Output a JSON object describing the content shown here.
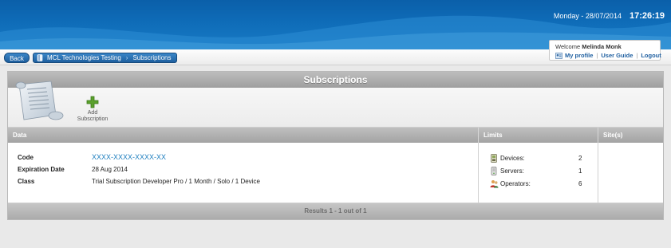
{
  "header": {
    "date": "Monday - 28/07/2014",
    "time": "17:26:19"
  },
  "nav": {
    "back_label": "Back",
    "breadcrumb": [
      "MCL Technologies Testing",
      "Subscriptions"
    ]
  },
  "user": {
    "welcome_prefix": "Welcome",
    "name": "Melinda Monk",
    "links": [
      "My profile",
      "User Guide",
      "Logout"
    ]
  },
  "panel": {
    "title": "Subscriptions",
    "toolbar": {
      "add_label_line1": "Add",
      "add_label_line2": "Subscription"
    },
    "columns": {
      "data": "Data",
      "limits": "Limits",
      "sites": "Site(s)"
    },
    "row": {
      "code_label": "Code",
      "code_value": "XXXX-XXXX-XXXX-XX",
      "expiration_label": "Expiration Date",
      "expiration_value": "28 Aug 2014",
      "class_label": "Class",
      "class_value": "Trial Subscription Developer Pro / 1 Month / Solo / 1 Device",
      "limits": [
        {
          "label": "Devices:",
          "value": "2",
          "icon": "device-icon"
        },
        {
          "label": "Servers:",
          "value": "1",
          "icon": "server-icon"
        },
        {
          "label": "Operators:",
          "value": "6",
          "icon": "operators-icon"
        }
      ]
    },
    "footer": "Results 1 - 1 out of 1"
  }
}
